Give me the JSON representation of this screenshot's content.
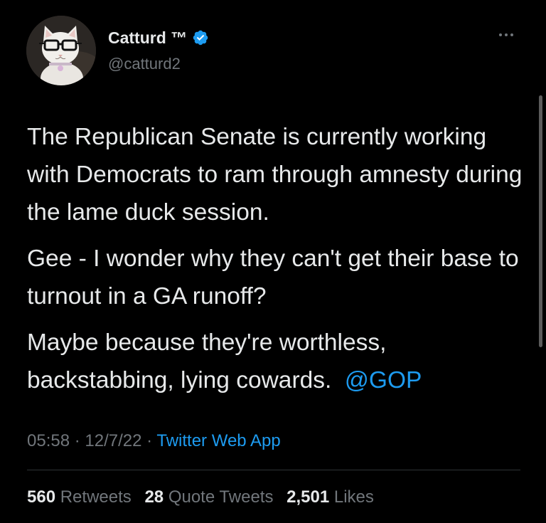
{
  "tweet": {
    "author": {
      "display_name": "Catturd ™",
      "handle": "@catturd2",
      "verified": true
    },
    "text": {
      "paragraph1": "The Republican Senate is currently working with Democrats to ram through amnesty during the lame duck session.",
      "paragraph2": "Gee - I wonder why they can't get their base to turnout in a GA runoff?",
      "paragraph3": "Maybe because they're worthless, backstabbing, lying cowards.  ",
      "mention": "@GOP"
    },
    "meta": {
      "time": "05:58",
      "separator": " · ",
      "date": "12/7/22",
      "source": "Twitter Web App"
    },
    "stats": {
      "retweets_count": "560",
      "retweets_label": "Retweets",
      "quotes_count": "28",
      "quotes_label": "Quote Tweets",
      "likes_count": "2,501",
      "likes_label": "Likes"
    }
  },
  "icons": {
    "verified": "verified-badge-icon",
    "more": "more-options-icon"
  },
  "colors": {
    "background": "#000000",
    "text": "#e7e9ea",
    "secondary": "#71767b",
    "accent": "#1d9bf0"
  }
}
